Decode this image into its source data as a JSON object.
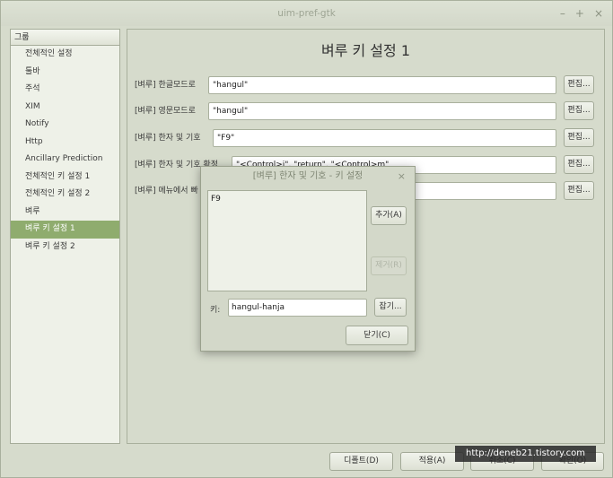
{
  "window": {
    "title": "uim-pref-gtk",
    "controls": [
      "–",
      "+",
      "×"
    ]
  },
  "sidebar": {
    "header": "그룹",
    "items": [
      {
        "label": "전체적인 설정"
      },
      {
        "label": "툴바"
      },
      {
        "label": "주석"
      },
      {
        "label": "XIM"
      },
      {
        "label": "Notify"
      },
      {
        "label": "Http"
      },
      {
        "label": "Ancillary Prediction"
      },
      {
        "label": "전체적인 키 설정 1"
      },
      {
        "label": "전체적인 키 설정 2"
      },
      {
        "label": "벼루"
      },
      {
        "label": "벼루 키 설정 1",
        "selected": true
      },
      {
        "label": "벼루 키 설정 2"
      }
    ]
  },
  "panel": {
    "title": "벼루 키 설정 1",
    "rows": [
      {
        "label": "[벼루] 한글모드로",
        "value": "\"hangul\"",
        "button": "편집..."
      },
      {
        "label": "[벼루] 영문모드로",
        "value": "\"hangul\"",
        "button": "편집..."
      },
      {
        "label": "[벼루] 한자 및 기호",
        "value": "\"F9\"",
        "button": "편집..."
      },
      {
        "label": "[벼루] 한자 및 기호 확정",
        "value": "\"<Control>j\", \"return\", \"<Control>m\"",
        "button": "편집..."
      },
      {
        "label": "[벼루] 메뉴에서 빠",
        "value": "",
        "button": "편집..."
      }
    ]
  },
  "buttons": {
    "default": "디폴트(D)",
    "apply": "적용(A)",
    "cancel": "취소(C)",
    "ok": "확인(O)"
  },
  "watermark": "http://deneb21.tistory.com",
  "dialog": {
    "title": "[벼루] 한자 및 기호 - 키 설정",
    "close": "×",
    "list": [
      "F9"
    ],
    "add": "추가(A)",
    "remove": "제거(R)",
    "key_label": "키:",
    "key_value": "hangul-hanja",
    "capture": "잡기...",
    "close_button": "닫기(C)"
  }
}
